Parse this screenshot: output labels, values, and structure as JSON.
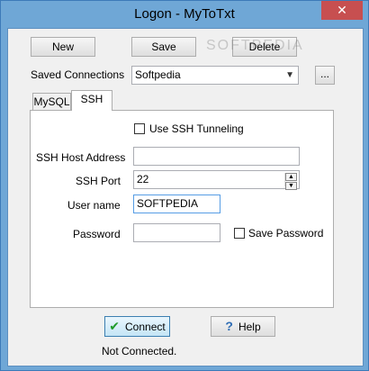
{
  "window": {
    "title": "Logon - MyToTxt",
    "close_glyph": "✕"
  },
  "toolbar": {
    "new_label": "New",
    "save_label": "Save",
    "delete_label": "Delete"
  },
  "saved_connections": {
    "label": "Saved Connections",
    "value": "Softpedia",
    "more_label": "..."
  },
  "tabs": [
    {
      "label": "MySQL",
      "active": false
    },
    {
      "label": "SSH",
      "active": true
    }
  ],
  "ssh": {
    "use_tunneling_label": "Use SSH Tunneling",
    "host_label": "SSH Host Address",
    "host_value": "",
    "port_label": "SSH Port",
    "port_value": "22",
    "username_label": "User name",
    "username_value": "SOFTPEDIA",
    "password_label": "Password",
    "password_value": "",
    "save_password_label": "Save Password"
  },
  "footer": {
    "connect_label": "Connect",
    "help_label": "Help",
    "status": "Not Connected."
  },
  "colors": {
    "titlebar": "#6fa7d6",
    "close": "#c74f50",
    "connect_check": "#1e9b2a",
    "help_icon": "#2f6db5"
  },
  "watermark": "SOFTPEDIA"
}
